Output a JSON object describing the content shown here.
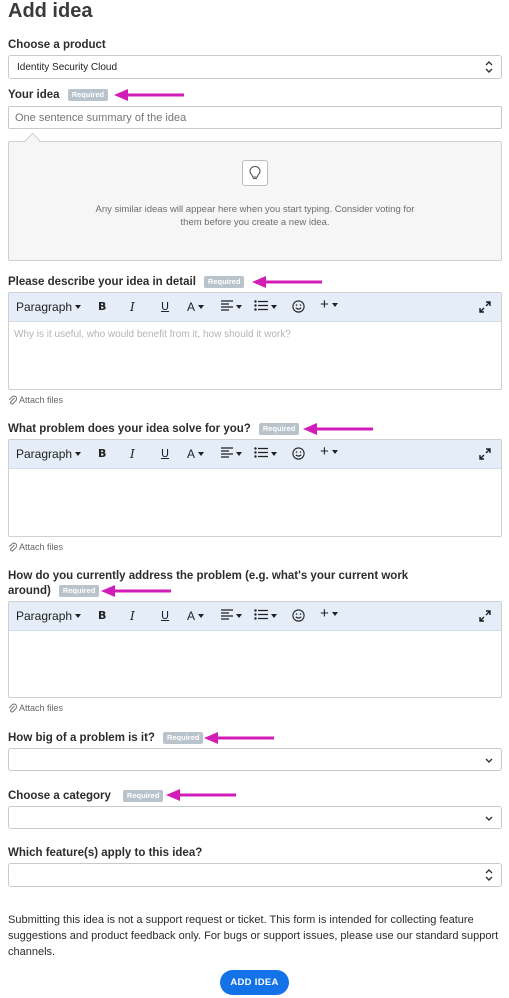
{
  "page": {
    "title": "Add idea"
  },
  "product": {
    "label": "Choose a product",
    "value": "Identity Security Cloud"
  },
  "idea": {
    "label": "Your idea",
    "required": "Required",
    "placeholder": "One sentence summary of the idea",
    "similar_text": "Any similar ideas will appear here when you start typing. Consider voting for them before you create a new idea."
  },
  "toolbar": {
    "paragraph": "Paragraph",
    "bold": "B",
    "italic": "I",
    "underline": "U",
    "font_color": "A",
    "plus": "+"
  },
  "describe": {
    "label": "Please describe your idea in detail",
    "required": "Required",
    "placeholder": "Why is it useful, who would benefit from it, how should it work?",
    "attach": "Attach files"
  },
  "problem": {
    "label": "What problem does your idea solve for you?",
    "required": "Required",
    "attach": "Attach files"
  },
  "address": {
    "label": "How do you currently address the problem (e.g. what's your current work around)",
    "required": "Required",
    "attach": "Attach files"
  },
  "bigness": {
    "label": "How big of a problem is it?",
    "required": "Required",
    "value": ""
  },
  "category": {
    "label": "Choose a category",
    "required": "Required",
    "value": ""
  },
  "features": {
    "label": "Which feature(s) apply to this idea?",
    "value": ""
  },
  "notice": "Submitting this idea is not a support request or ticket. This form is intended for collecting feature suggestions and product feedback only. For bugs or support issues, please use our standard support channels.",
  "submit": {
    "label": "ADD IDEA"
  },
  "colors": {
    "accent": "#1472e8",
    "arrow": "#d21cb8",
    "toolbar_bg": "#e4edf8",
    "badge": "#b9c3cc"
  }
}
